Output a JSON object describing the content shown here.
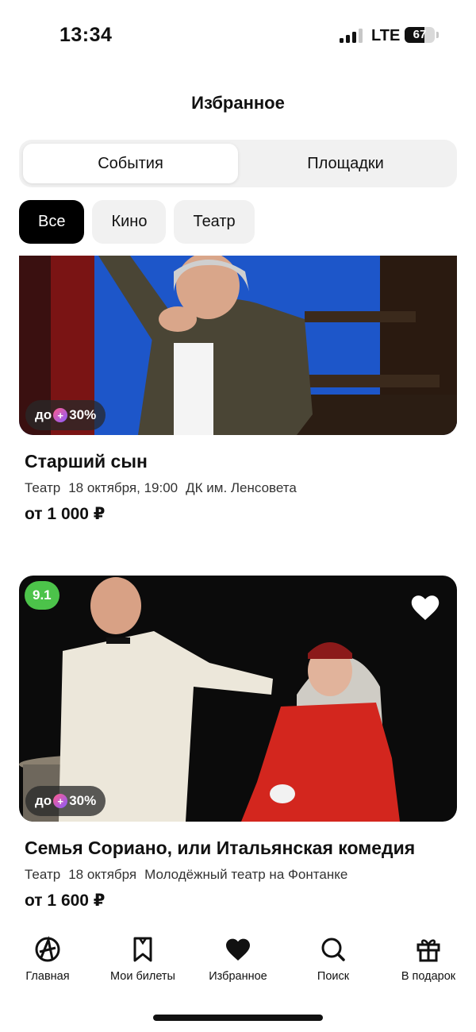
{
  "status": {
    "time": "13:34",
    "network": "LTE",
    "battery": "67",
    "battery_level": 0.67
  },
  "header": {
    "title": "Избранное"
  },
  "segments": [
    {
      "label": "События",
      "active": true
    },
    {
      "label": "Площадки",
      "active": false
    }
  ],
  "filters": [
    {
      "label": "Все",
      "active": true
    },
    {
      "label": "Кино",
      "active": false
    },
    {
      "label": "Театр",
      "active": false
    }
  ],
  "events": [
    {
      "title": "Старший сын",
      "category": "Театр",
      "date": "18 октября, 19:00",
      "venue": "ДК им. Ленсовета",
      "price": "от 1 000 ₽",
      "discount_prefix": "до",
      "discount_value": "30%"
    },
    {
      "title": "Семья Сориано, или Итальянская комедия",
      "category": "Театр",
      "date": "18 октября",
      "venue": "Молодёжный театр на Фонтанке",
      "price": "от 1 600 ₽",
      "rating": "9.1",
      "discount_prefix": "до",
      "discount_value": "30%"
    }
  ],
  "tabbar": [
    {
      "label": "Главная",
      "icon": "home-logo-icon"
    },
    {
      "label": "Мои билеты",
      "icon": "ticket-bookmark-icon"
    },
    {
      "label": "Избранное",
      "icon": "heart-icon",
      "active": true
    },
    {
      "label": "Поиск",
      "icon": "search-icon"
    },
    {
      "label": "В подарок",
      "icon": "gift-icon"
    }
  ],
  "colors": {
    "accent_dark": "#000000",
    "rating_green": "#4cc34a",
    "chip_bg": "#f1f1f1"
  }
}
